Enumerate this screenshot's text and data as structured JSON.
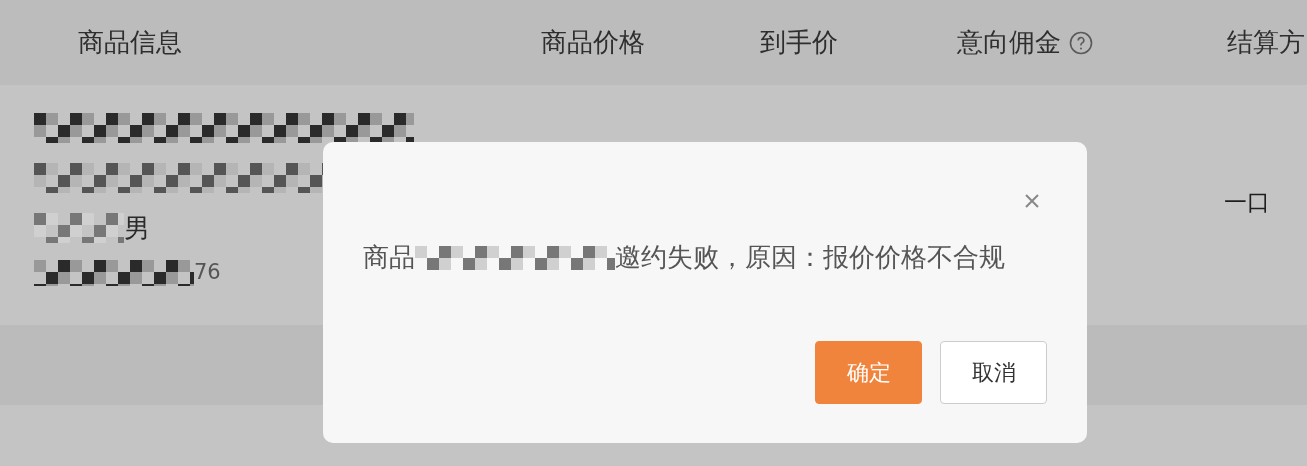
{
  "table": {
    "columns": [
      {
        "label": "商品信息"
      },
      {
        "label": "商品价格"
      },
      {
        "label": "到手价"
      },
      {
        "label": "意向佣金",
        "help": true
      },
      {
        "label": "结算方"
      }
    ],
    "rows": [
      {
        "title_lines": [
          [
            {
              "kind": "redacted"
            }
          ],
          [
            {
              "kind": "redacted"
            }
          ],
          [
            {
              "kind": "redacted"
            },
            {
              "kind": "text",
              "text": "男"
            }
          ]
        ],
        "id_line": [
          {
            "kind": "redacted"
          },
          {
            "kind": "text",
            "text": "76"
          }
        ],
        "settlement": "一口"
      }
    ]
  },
  "dialog": {
    "message": [
      {
        "kind": "text",
        "text": "商品"
      },
      {
        "kind": "redacted"
      },
      {
        "kind": "text",
        "text": "邀约失败，原因：报价价格不合规"
      }
    ],
    "buttons": [
      {
        "label": "确定",
        "primary": true
      },
      {
        "label": "取消",
        "primary": false
      }
    ]
  }
}
